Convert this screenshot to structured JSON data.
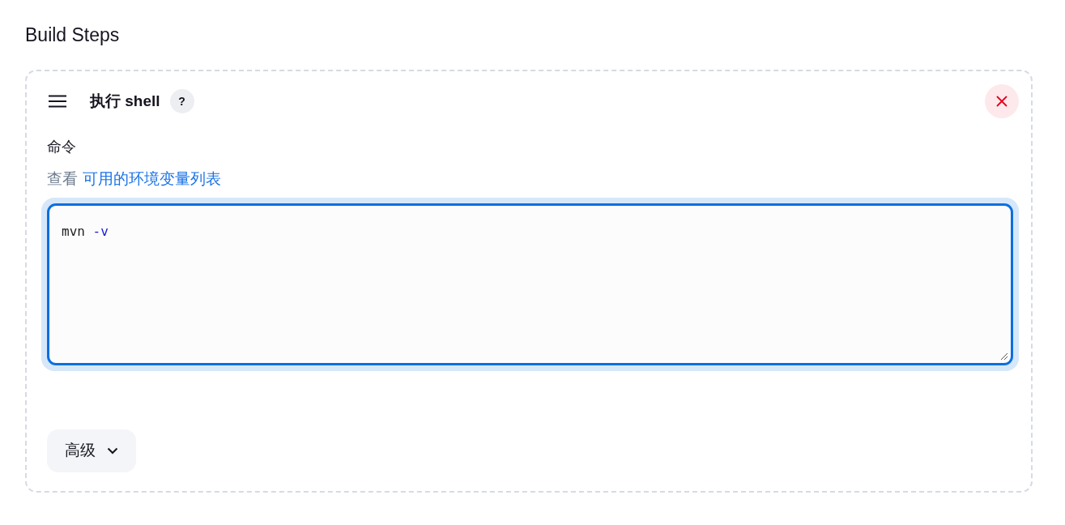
{
  "section_title": "Build Steps",
  "step": {
    "title": "执行 shell",
    "help": "?",
    "field_label": "命令",
    "hint": {
      "text": "查看",
      "link": "可用的环境变量列表"
    },
    "command": {
      "focused": true,
      "tokens": [
        {
          "text": "mvn",
          "kind": "word"
        },
        {
          "text": "-v",
          "kind": "option"
        }
      ]
    },
    "advanced_button": "高级"
  }
}
